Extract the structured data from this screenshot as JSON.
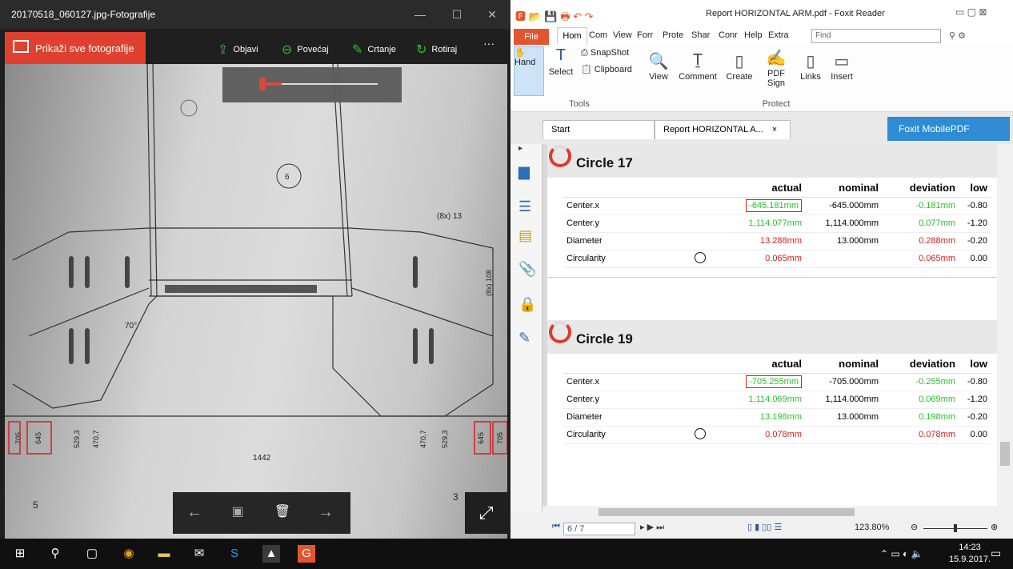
{
  "photos": {
    "title": "20170518_060127.jpg-Fotografije",
    "show_all": "Prikaži sve fotografije",
    "share": "Objavi",
    "zoom": "Povećaj",
    "draw": "Crtanje",
    "rotate": "Rotiraj",
    "more": "···",
    "drawing_labels": {
      "circle": "6",
      "d8x13": "(8x) 13",
      "r705": "705",
      "r645": "645",
      "r5293": "529,3",
      "r4707": "470,7",
      "c1442": "1442",
      "l4707": "470,7",
      "l5293": "529,3",
      "l645": "645",
      "l705": "705",
      "b5": "5",
      "b3": "3",
      "a70": "70°",
      "v108": "(8x) 108"
    }
  },
  "foxit": {
    "title": "Report HORIZONTAL ARM.pdf - Foxit Reader",
    "tabs": [
      "File",
      "Hom",
      "Com",
      "View",
      "Forr",
      "Prote",
      "Shar",
      "Conr",
      "Help",
      "Extra"
    ],
    "find_placeholder": "Find",
    "ribbon": {
      "hand": "Hand",
      "select": "Select",
      "snapshot": "SnapShot",
      "clipboard": "Clipboard",
      "tools": "Tools",
      "view": "View",
      "comment": "Comment",
      "create": "Create",
      "pdf_sign": "PDF Sign",
      "protect": "Protect",
      "links": "Links",
      "insert": "Insert"
    },
    "doc_tabs": {
      "start": "Start",
      "report": "Report HORIZONTAL A...",
      "close": "×",
      "mobile": "Foxit MobilePDF"
    },
    "circles": [
      {
        "name": "Circle 17",
        "headers": [
          "actual",
          "nominal",
          "deviation",
          "low"
        ],
        "rows": [
          {
            "label": "Center.x",
            "actual": "-645.181mm",
            "nominal": "-645.000mm",
            "deviation": "-0.181mm",
            "low": "-0.80",
            "color": "g",
            "boxed": true
          },
          {
            "label": "Center.y",
            "actual": "1,114.077mm",
            "nominal": "1,114.000mm",
            "deviation": "0.077mm",
            "low": "-1.20",
            "color": "g"
          },
          {
            "label": "Diameter",
            "actual": "13.288mm",
            "nominal": "13.000mm",
            "deviation": "0.288mm",
            "low": "-0.20",
            "color": "r"
          },
          {
            "label": "Circularity",
            "actual": "0.065mm",
            "nominal": "",
            "deviation": "0.065mm",
            "low": "0.00",
            "color": "r",
            "icon": true
          }
        ]
      },
      {
        "name": "Circle 19",
        "headers": [
          "actual",
          "nominal",
          "deviation",
          "low"
        ],
        "rows": [
          {
            "label": "Center.x",
            "actual": "-705.255mm",
            "nominal": "-705.000mm",
            "deviation": "-0.255mm",
            "low": "-0.80",
            "color": "g",
            "boxed": true
          },
          {
            "label": "Center.y",
            "actual": "1,114.069mm",
            "nominal": "1,114.000mm",
            "deviation": "0.069mm",
            "low": "-1.20",
            "color": "g"
          },
          {
            "label": "Diameter",
            "actual": "13.198mm",
            "nominal": "13.000mm",
            "deviation": "0.198mm",
            "low": "-0.20",
            "color": "g"
          },
          {
            "label": "Circularity",
            "actual": "0.078mm",
            "nominal": "",
            "deviation": "0.078mm",
            "low": "0.00",
            "color": "r",
            "icon": true
          }
        ]
      }
    ],
    "status": {
      "page": "6 / 7",
      "zoom": "123.80%"
    }
  },
  "taskbar": {
    "time": "14:23",
    "date": "15.9.2017."
  }
}
